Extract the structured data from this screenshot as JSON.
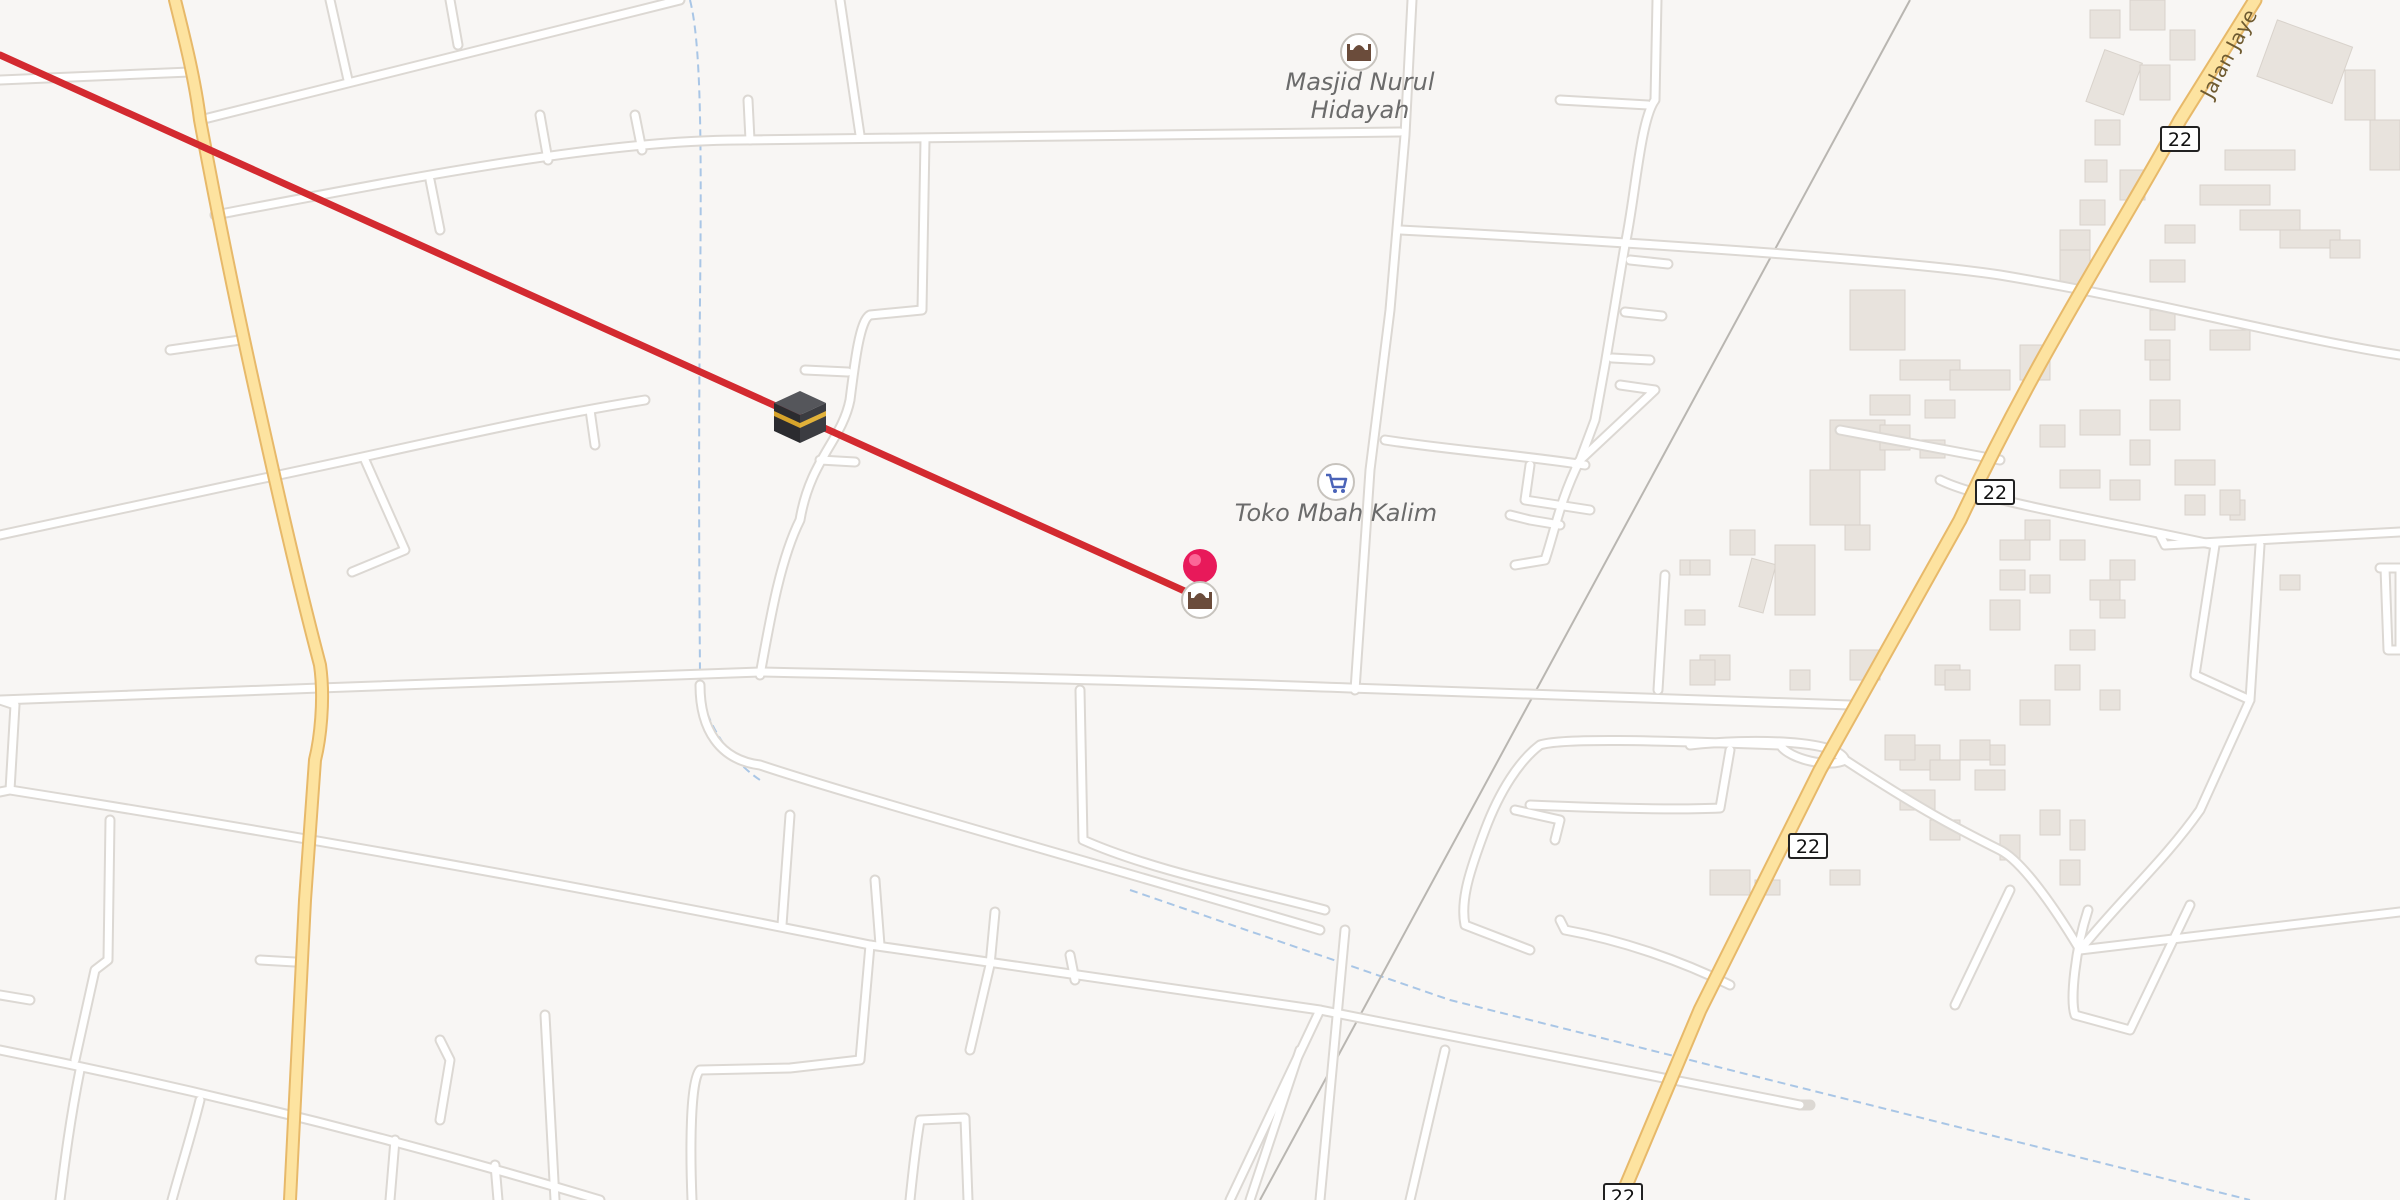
{
  "map": {
    "pois": [
      {
        "id": "mosque-nurul-hidayah",
        "icon": "mosque-icon",
        "lines": [
          "Masjid Nurul",
          "Hidayah"
        ]
      },
      {
        "id": "shop-mbah-kalim",
        "icon": "shopping-cart-icon",
        "lines": [
          "Toko Mbah Kalim"
        ]
      },
      {
        "id": "mosque-at-pin",
        "icon": "mosque-icon",
        "lines": []
      }
    ],
    "road_shields": [
      {
        "label": "22"
      },
      {
        "label": "22"
      },
      {
        "label": "22"
      },
      {
        "label": "22"
      }
    ],
    "road_labels": [
      {
        "text": "Jalan Jaye"
      }
    ],
    "markers": {
      "location_pin": {
        "icon": "map-pin-icon",
        "color": "#e8195a"
      },
      "kaaba": {
        "icon": "kaaba-icon"
      }
    },
    "qibla_line": {
      "color": "#d32a30"
    },
    "colors": {
      "background": "#f8f6f4",
      "road": "#ffffff",
      "road_casing": "#dcd8d3",
      "main_road": "#fde3a0",
      "main_road_casing": "#e7b96a",
      "building": "#e8e3dd",
      "waterway": "#a9c6e6",
      "railway": "#b9b6b1"
    }
  }
}
